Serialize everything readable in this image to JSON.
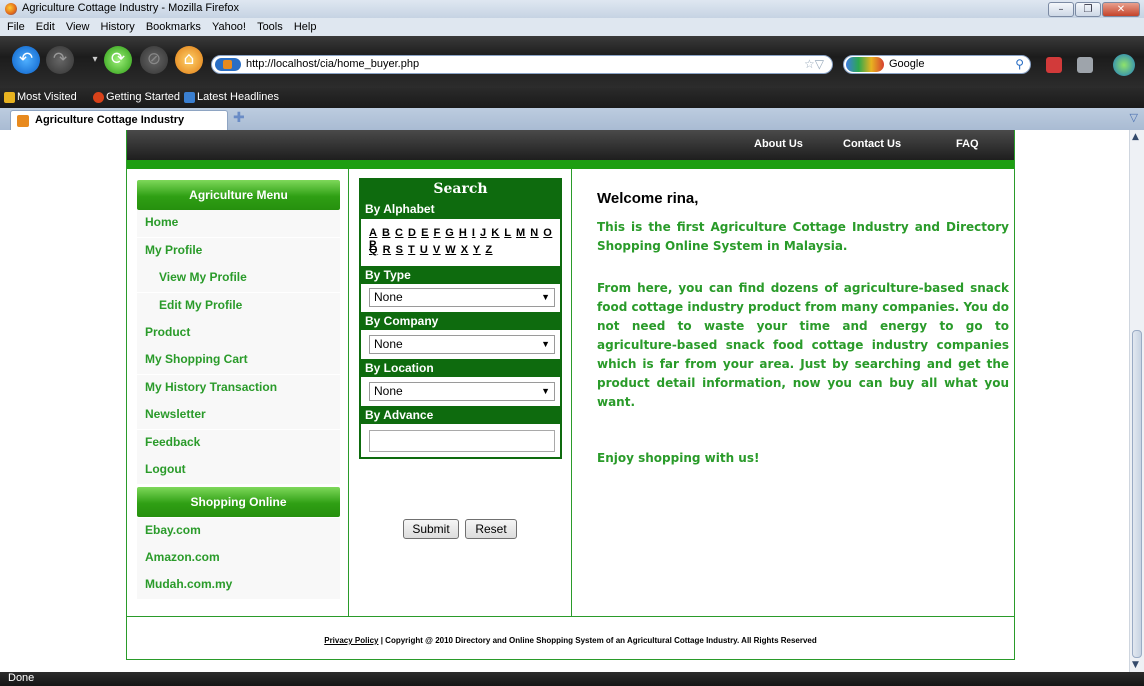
{
  "window": {
    "title": "Agriculture Cottage Industry - Mozilla Firefox",
    "buttons": [
      "–",
      "❐",
      "✕"
    ]
  },
  "menubar": [
    "File",
    "Edit",
    "View",
    "History",
    "Bookmarks",
    "Yahoo!",
    "Tools",
    "Help"
  ],
  "navbar": {
    "url": "http://localhost/cia/home_buyer.php",
    "search_engine": "Google"
  },
  "bookmarks": [
    "Most Visited",
    "Getting Started",
    "Latest Headlines"
  ],
  "tab": {
    "label": "Agriculture Cottage Industry"
  },
  "site": {
    "topnav": [
      "About Us",
      "Contact Us",
      "FAQ"
    ],
    "left_menu": {
      "heading": "Agriculture Menu",
      "items": [
        "Home",
        "My Profile",
        "View My Profile",
        "Edit My Profile",
        "Product",
        "My Shopping Cart",
        "My History Transaction",
        "Newsletter",
        "Feedback",
        "Logout"
      ],
      "shopping_heading": "Shopping Online",
      "shopping_items": [
        "Ebay.com",
        "Amazon.com",
        "Mudah.com.my"
      ]
    },
    "search": {
      "title": "Search",
      "by_alphabet": "By Alphabet",
      "alphabet_row1": [
        "A",
        "B",
        "C",
        "D",
        "E",
        "F",
        "G",
        "H",
        "I",
        "J",
        "K",
        "L",
        "M",
        "N",
        "O",
        "P"
      ],
      "alphabet_row2": [
        "Q",
        "R",
        "S",
        "T",
        "U",
        "V",
        "W",
        "X",
        "Y",
        "Z"
      ],
      "by_type": "By Type",
      "type_value": "None",
      "by_company": "By Company",
      "company_value": "None",
      "by_location": "By Location",
      "location_value": "None",
      "by_advance": "By Advance",
      "advance_value": "",
      "submit": "Submit",
      "reset": "Reset"
    },
    "main": {
      "welcome": "Welcome rina,",
      "p1": "This is the first Agriculture Cottage Industry and Directory Shopping Online System in Malaysia.",
      "p2": "From here, you can find dozens of agriculture-based snack food cottage industry product from many companies. You do not need to waste your time and energy to go to agriculture-based snack food cottage industry companies which is far from your area. Just by searching and get the product detail information, now you can buy all what you want.",
      "p3": "Enjoy shopping with us!"
    },
    "footer": {
      "privacy": "Privacy Policy",
      "copyright": " | Copyright @ 2010 Directory and Online Shopping System of an Agricultural Cottage Industry. All Rights Reserved"
    }
  },
  "status": "Done"
}
